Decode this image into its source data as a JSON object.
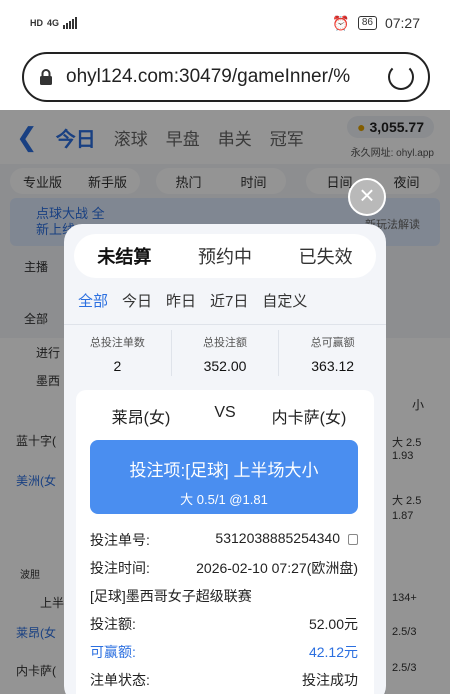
{
  "status": {
    "net_left": "HD",
    "net_small": "4G",
    "battery": "86",
    "time": "07:27"
  },
  "url": {
    "text": "ohyl124.com:30479/gameInner/%"
  },
  "app": {
    "tabs": [
      {
        "label": "今日",
        "active": true
      },
      {
        "label": "滚球"
      },
      {
        "label": "早盘"
      },
      {
        "label": "串关"
      },
      {
        "label": "冠军"
      }
    ],
    "balance": "3,055.77",
    "domain_label": "永久网址: ohyl.app",
    "toggles": [
      "专业版",
      "新手版",
      "热门",
      "时间",
      "日间",
      "夜间"
    ],
    "banner_left": "点球大战 全新上线",
    "banner_right": "新玩法解读",
    "side_items": [
      "主播",
      "全部",
      "进行",
      "墨西",
      "蓝十字(",
      "美洲(女",
      "波胆",
      "上半",
      "莱昂(女",
      "内卡萨("
    ],
    "right_items": [
      "小",
      "大 2.5",
      "1.93",
      "大 2.5",
      "1.87",
      "134+",
      "2.5/3",
      "2.5/3"
    ]
  },
  "modal": {
    "close_icon": "close-icon",
    "tabs": [
      {
        "label": "未结算",
        "active": true
      },
      {
        "label": "预约中"
      },
      {
        "label": "已失效"
      }
    ],
    "filters": [
      {
        "label": "全部",
        "active": true
      },
      {
        "label": "今日"
      },
      {
        "label": "昨日"
      },
      {
        "label": "近7日"
      },
      {
        "label": "自定义"
      }
    ],
    "stats": [
      {
        "label": "总投注单数",
        "value": "2"
      },
      {
        "label": "总投注额",
        "value": "352.00"
      },
      {
        "label": "总可赢额",
        "value": "363.12"
      }
    ],
    "card": {
      "home": "莱昂(女)",
      "vs": "VS",
      "away": "内卡萨(女)",
      "bet_line1": "投注项:[足球] 上半场大小",
      "bet_line2": "大 0.5/1 @1.81",
      "order_no_label": "投注单号:",
      "order_no": "5312038885254340",
      "time_label": "投注时间:",
      "time": "2026-02-10 07:27(欧洲盘)",
      "league": "[足球]墨西哥女子超级联赛",
      "amount_label": "投注额:",
      "amount": "52.00元",
      "win_label": "可赢额:",
      "win": "42.12元",
      "state_label": "注单状态:",
      "state": "投注成功"
    }
  }
}
